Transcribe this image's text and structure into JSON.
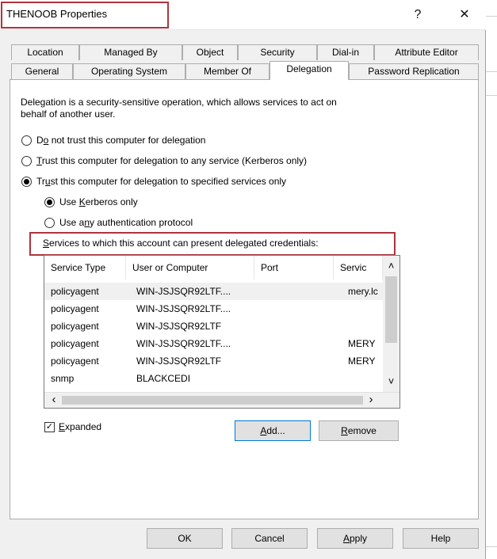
{
  "window": {
    "title": "THENOOB Properties",
    "help_glyph": "?",
    "close_glyph": "✕"
  },
  "tabs_row1": [
    "Location",
    "Managed By",
    "Object",
    "Security",
    "Dial-in",
    "Attribute Editor"
  ],
  "tabs_row2": [
    "General",
    "Operating System",
    "Member Of",
    "Delegation",
    "Password Replication"
  ],
  "active_tab": "Delegation",
  "delegation": {
    "description_line1": "Delegation is a security-sensitive operation, which allows services to act on",
    "description_line2": "behalf of another user.",
    "option_no_trust": {
      "pre": "D",
      "ul": "o",
      "post": " not trust this computer for delegation"
    },
    "option_trust_any": {
      "pre": "",
      "ul": "T",
      "post": "rust this computer for delegation to any service (Kerberos only)"
    },
    "option_trust_specified": {
      "pre": "Tr",
      "ul": "u",
      "post": "st this computer for delegation to specified services only"
    },
    "sub_kerberos": {
      "pre": "Use ",
      "ul": "K",
      "post": "erberos only"
    },
    "sub_any_protocol": {
      "pre": "Use a",
      "ul": "n",
      "post": "y authentication protocol"
    },
    "selected_option": "trust_specified",
    "selected_sub": "kerberos",
    "services_label": {
      "pre": "",
      "ul": "S",
      "post": "ervices to which this account can present delegated credentials:"
    }
  },
  "services_table": {
    "columns": [
      "Service Type",
      "User or Computer",
      "Port",
      "Servic"
    ],
    "rows": [
      [
        "policyagent",
        "WIN-JSJSQR92LTF....",
        "",
        "mery.lc"
      ],
      [
        "policyagent",
        "WIN-JSJSQR92LTF....",
        "",
        ""
      ],
      [
        "policyagent",
        "WIN-JSJSQR92LTF",
        "",
        ""
      ],
      [
        "policyagent",
        "WIN-JSJSQR92LTF....",
        "",
        "MERY"
      ],
      [
        "policyagent",
        "WIN-JSJSQR92LTF",
        "",
        "MERY"
      ],
      [
        "snmp",
        "BLACKCEDI",
        "",
        ""
      ]
    ],
    "scroll_up": "˄",
    "scroll_down": "˅",
    "scroll_left": "‹",
    "scroll_right": "›"
  },
  "expanded": {
    "pre": "",
    "ul": "E",
    "post": "xpanded",
    "checked": true,
    "check_glyph": "✓"
  },
  "buttons": {
    "add": {
      "pre": "",
      "ul": "A",
      "post": "dd..."
    },
    "remove": {
      "pre": "",
      "ul": "R",
      "post": "emove"
    },
    "ok": "OK",
    "cancel": "Cancel",
    "apply": {
      "pre": "",
      "ul": "A",
      "post": "pply"
    },
    "help": "Help"
  },
  "colors": {
    "highlight_red": "#b0333c",
    "dialog_bg": "#f0f0f0",
    "focus_blue": "#0078d7"
  }
}
